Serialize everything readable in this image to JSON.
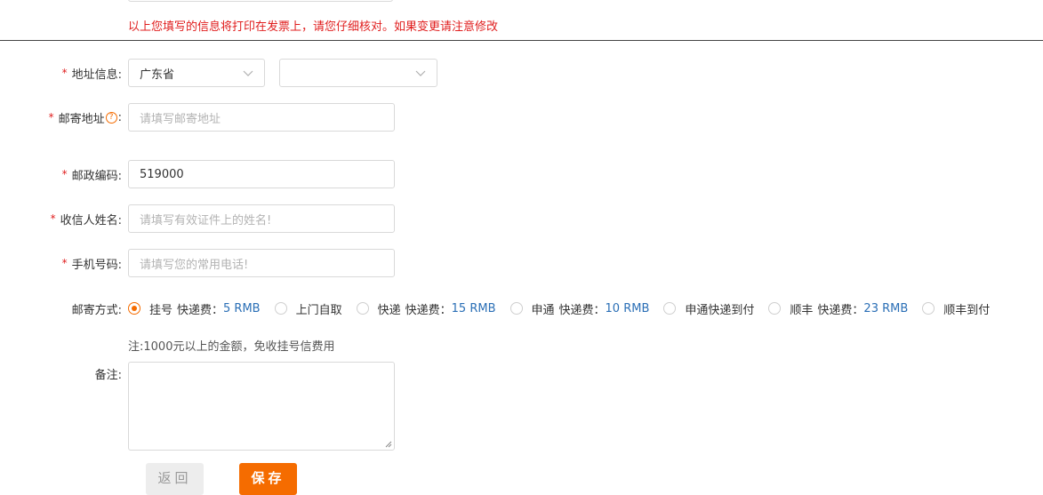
{
  "notice": "以上您填写的信息将打印在发票上，请您仔细核对。如果变更请注意修改",
  "form": {
    "address_info": {
      "label": "地址信息:",
      "province": "广东省",
      "city": ""
    },
    "mail_address": {
      "label": "邮寄地址",
      "colon": ":",
      "help": "?",
      "placeholder": "请填写邮寄地址",
      "value": ""
    },
    "postal_code": {
      "label": "邮政编码:",
      "value": "519000"
    },
    "recipient_name": {
      "label": "收信人姓名:",
      "placeholder": "请填写有效证件上的姓名!",
      "value": ""
    },
    "phone": {
      "label": "手机号码:",
      "placeholder": "请填写您的常用电话!",
      "value": ""
    },
    "mail_method": {
      "label": "邮寄方式:",
      "options": [
        {
          "name": "挂号",
          "fee_label": "快递费：",
          "fee": "5 RMB",
          "checked": true
        },
        {
          "name": "上门自取",
          "fee_label": "",
          "fee": "",
          "checked": false
        },
        {
          "name": "快递",
          "fee_label": "快递费：",
          "fee": "15 RMB",
          "checked": false
        },
        {
          "name": "申通",
          "fee_label": "快递费：",
          "fee": "10 RMB",
          "checked": false
        },
        {
          "name": "申通快递到付",
          "fee_label": "",
          "fee": "",
          "checked": false
        },
        {
          "name": "顺丰",
          "fee_label": "快递费：",
          "fee": "23 RMB",
          "checked": false
        },
        {
          "name": "顺丰到付",
          "fee_label": "",
          "fee": "",
          "checked": false
        }
      ]
    },
    "note": "注:1000元以上的金额，免收挂号信费用",
    "remarks": {
      "label": "备注:",
      "value": ""
    },
    "required_mark": "*"
  },
  "buttons": {
    "back": "返回",
    "save": "保存"
  },
  "colors": {
    "accent": "#f56c00",
    "required": "#e01e1e",
    "fee": "#2b6fb6"
  }
}
